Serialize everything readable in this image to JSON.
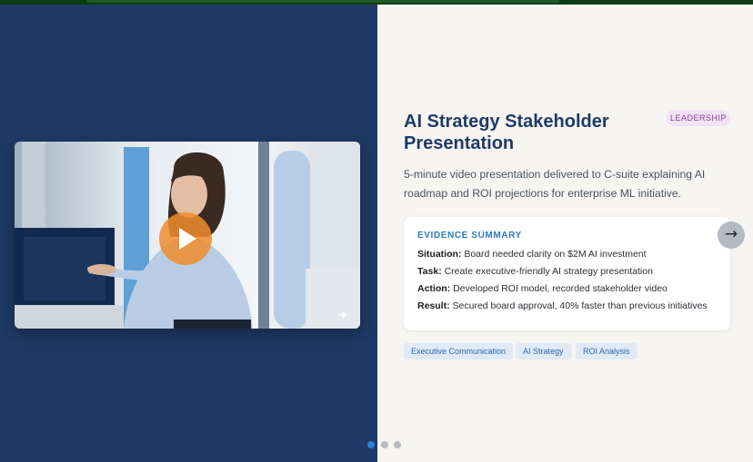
{
  "slide": {
    "badge": "LEADERSHIP",
    "title": "AI Strategy Stakeholder Presentation",
    "description": "5-minute video presentation delivered to C-suite explaining AI roadmap and ROI projections for enterprise ML initiative.",
    "evidence": {
      "heading": "EVIDENCE SUMMARY",
      "items": [
        {
          "label": "Situation:",
          "text": "Board needed clarity on $2M AI investment"
        },
        {
          "label": "Task:",
          "text": "Create executive-friendly AI strategy presentation"
        },
        {
          "label": "Action:",
          "text": "Developed ROI model, recorded stakeholder video"
        },
        {
          "label": "Result:",
          "text": "Secured board approval, 40% faster than previous initiatives"
        }
      ]
    },
    "tags": [
      "Executive Communication",
      "AI Strategy",
      "ROI Analysis"
    ]
  },
  "carousel": {
    "next_glyph": "→",
    "slide_count": 3,
    "active_index": 0
  },
  "video": {
    "play_icon": "play-icon",
    "sparkle_glyph": "✦"
  },
  "colors": {
    "left_panel": "#1f3a66",
    "accent": "#2b7fd4",
    "badge_bg": "#f1e2f4",
    "badge_text": "#8a3e9a",
    "play_button": "#f08c2d"
  }
}
